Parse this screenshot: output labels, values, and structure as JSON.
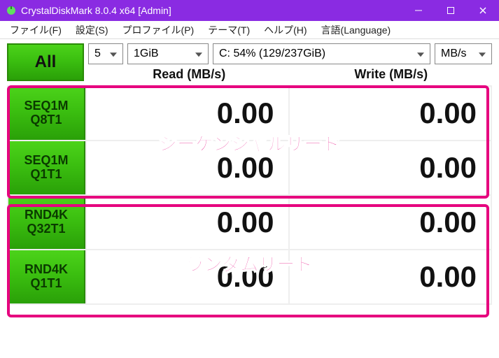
{
  "titlebar": {
    "title": "CrystalDiskMark 8.0.4 x64 [Admin]"
  },
  "menu": {
    "file": "ファイル(F)",
    "settings": "設定(S)",
    "profile": "プロファイル(P)",
    "theme": "テーマ(T)",
    "help": "ヘルプ(H)",
    "language": "言語(Language)"
  },
  "controls": {
    "all_label": "All",
    "count": "5",
    "size": "1GiB",
    "drive": "C: 54% (129/237GiB)",
    "unit": "MB/s"
  },
  "headers": {
    "read": "Read (MB/s)",
    "write": "Write (MB/s)"
  },
  "rows": [
    {
      "l1": "SEQ1M",
      "l2": "Q8T1",
      "read": "0.00",
      "write": "0.00"
    },
    {
      "l1": "SEQ1M",
      "l2": "Q1T1",
      "read": "0.00",
      "write": "0.00"
    },
    {
      "l1": "RND4K",
      "l2": "Q32T1",
      "read": "0.00",
      "write": "0.00"
    },
    {
      "l1": "RND4K",
      "l2": "Q1T1",
      "read": "0.00",
      "write": "0.00"
    }
  ],
  "annotations": {
    "sequential": "シーケンシャルリード",
    "random": "ランダムリード"
  }
}
